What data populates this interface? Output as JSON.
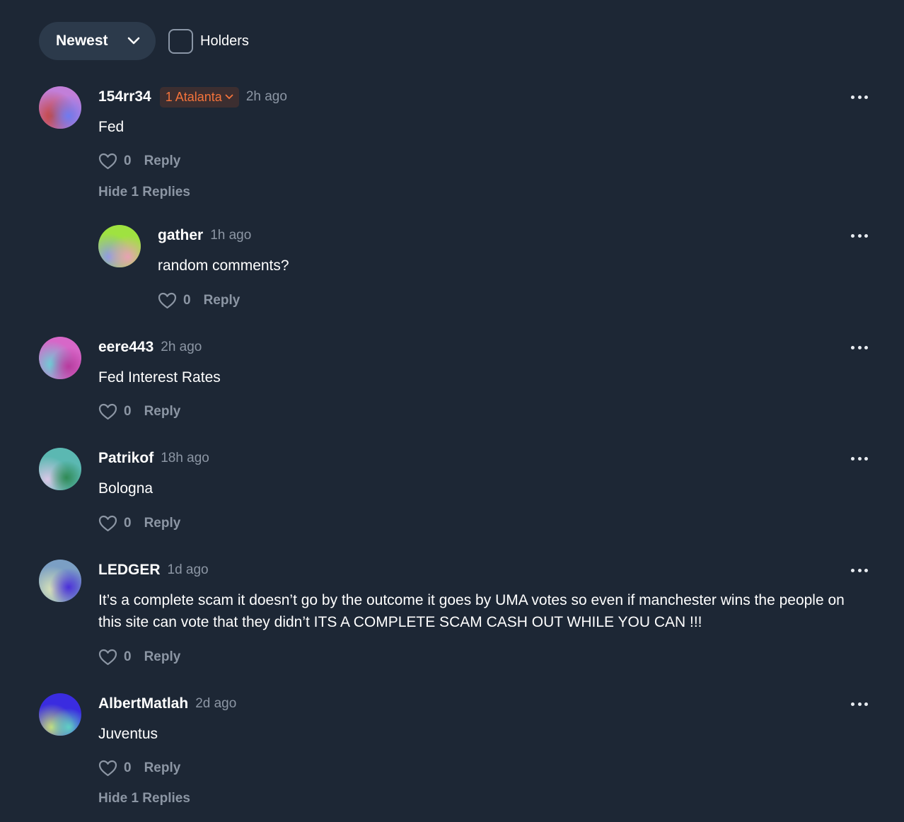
{
  "filters": {
    "sort_label": "Newest",
    "holders_label": "Holders"
  },
  "comments": [
    {
      "username": "154rr34",
      "badge": "1 Atalanta",
      "time": "2h ago",
      "text": "Fed",
      "likes": "0",
      "reply_label": "Reply",
      "hide_replies_label": "Hide 1 Replies",
      "replies": [
        {
          "username": "gather",
          "time": "1h ago",
          "text": "random comments?",
          "likes": "0",
          "reply_label": "Reply"
        }
      ]
    },
    {
      "username": "eere443",
      "time": "2h ago",
      "text": "Fed Interest Rates",
      "likes": "0",
      "reply_label": "Reply"
    },
    {
      "username": "Patrikof",
      "time": "18h ago",
      "text": "Bologna",
      "likes": "0",
      "reply_label": "Reply"
    },
    {
      "username": "LEDGER",
      "time": "1d ago",
      "text": "It’s a complete scam it doesn’t go by the outcome it goes by UMA votes so even if manchester wins the people on this site can vote that they didn’t ITS A COMPLETE SCAM CASH OUT WHILE YOU CAN !!!",
      "likes": "0",
      "reply_label": "Reply"
    },
    {
      "username": "AlbertMatlah",
      "time": "2d ago",
      "text": "Juventus",
      "likes": "0",
      "reply_label": "Reply",
      "hide_replies_label": "Hide 1 Replies"
    }
  ],
  "colors": {
    "background": "#1d2735",
    "badge_text": "#f4733b",
    "muted_text": "#8c96a4"
  }
}
